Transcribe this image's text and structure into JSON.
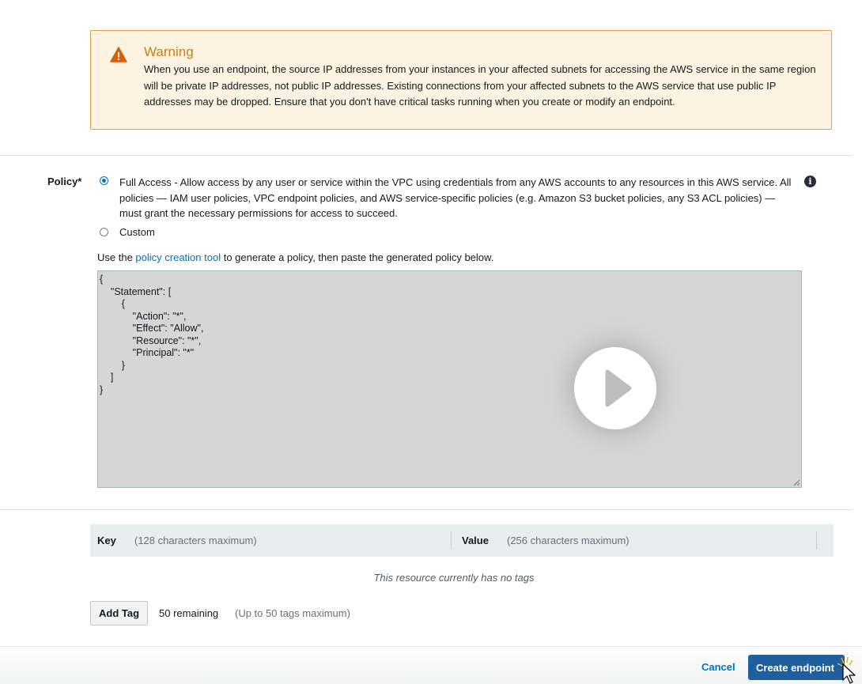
{
  "warning": {
    "title": "Warning",
    "text": "When you use an endpoint, the source IP addresses from your instances in your affected subnets for accessing the AWS service in the same region will be private IP addresses, not public IP addresses. Existing connections from your affected subnets to the AWS service that use public IP addresses may be dropped. Ensure that you don't have critical tasks running when you create or modify an endpoint.",
    "icon": "warning-triangle-icon",
    "accent": "#d47a12"
  },
  "policy": {
    "label": "Policy*",
    "full_access_text": "Full Access - Allow access by any user or service within the VPC using credentials from any AWS accounts to any resources in this AWS service. All policies — IAM user policies, VPC endpoint policies, and AWS service-specific policies (e.g. Amazon S3 bucket policies, any S3 ACL policies) — must grant the necessary permissions for access to succeed.",
    "custom_label": "Custom",
    "selected": "Full Access",
    "use_prefix": "Use the ",
    "link_text": "policy creation tool",
    "use_suffix": " to generate a policy, then paste the generated policy below.",
    "document": "{\n    \"Statement\": [\n        {\n            \"Action\": \"*\",\n            \"Effect\": \"Allow\",\n            \"Resource\": \"*\",\n            \"Principal\": \"*\"\n        }\n    ]\n}"
  },
  "tags": {
    "key_header": "Key",
    "key_hint": "(128 characters maximum)",
    "value_header": "Value",
    "value_hint": "(256 characters maximum)",
    "empty_text": "This resource currently has no tags",
    "add_button": "Add Tag",
    "remaining": "50 remaining",
    "max_note": "(Up to 50 tags maximum)"
  },
  "footer": {
    "cancel": "Cancel",
    "create": "Create endpoint"
  },
  "colors": {
    "link": "#0073bb",
    "primary_button": "#1f5f9e"
  }
}
